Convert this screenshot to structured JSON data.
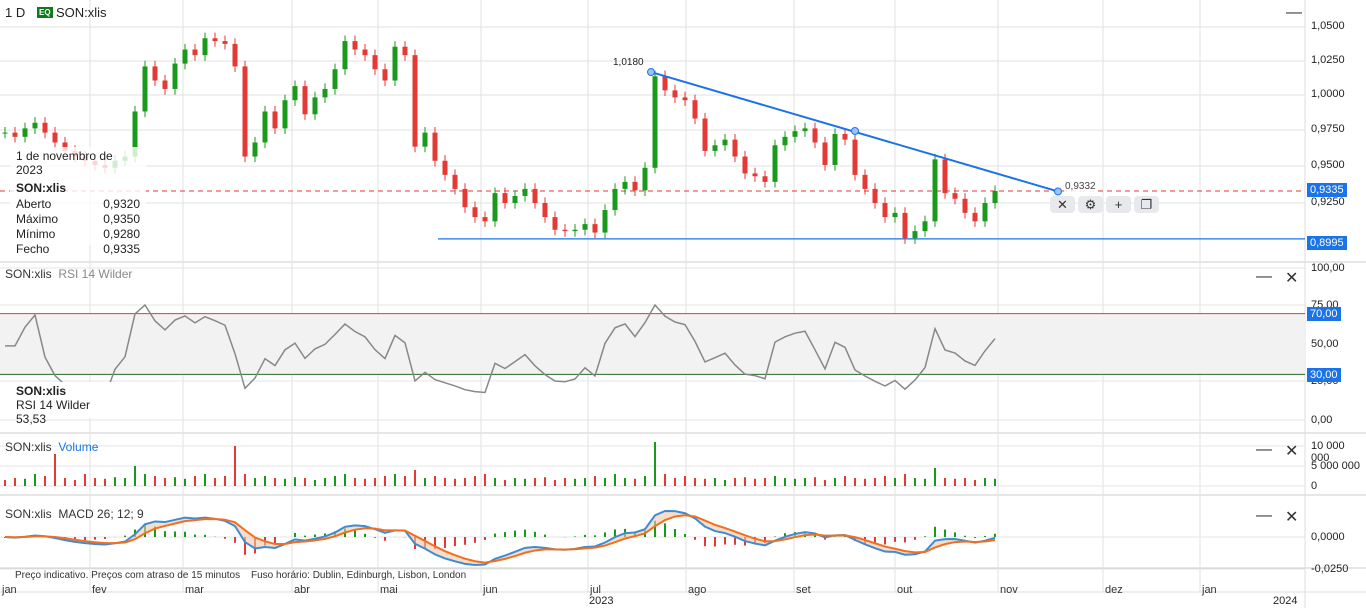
{
  "header": {
    "interval": "1 D",
    "badge": "EQ",
    "symbol": "SON:xlis"
  },
  "tooltip": {
    "date": "1 de novembro de 2023",
    "symbol": "SON:xlis",
    "rows": [
      {
        "label": "Aberto",
        "value": "0,9320"
      },
      {
        "label": "Máximo",
        "value": "0,9350"
      },
      {
        "label": "Mínimo",
        "value": "0,9280"
      },
      {
        "label": "Fecho",
        "value": "0,9335"
      }
    ]
  },
  "price_axis": {
    "ticks": [
      "1,0500",
      "1,0250",
      "1,0000",
      "0,9750",
      "0,9500",
      "0,9250"
    ],
    "last_price": "0,9335",
    "support_level": "0,8995"
  },
  "annotations": {
    "trend_high": "1,0180",
    "trend_end": "0,9332"
  },
  "drawing_toolbar": {
    "close": "✕",
    "settings": "⚙",
    "add": "+",
    "copy": "❐"
  },
  "rsi": {
    "title": "SON:xlis",
    "indicator": "RSI 14 Wilder",
    "legend_symbol": "SON:xlis",
    "legend_label": "RSI 14 Wilder",
    "value": "53,53",
    "ticks": [
      "100,00",
      "75,00",
      "50,00",
      "25,00",
      "0,00"
    ],
    "upper": "70,00",
    "lower": "30,00"
  },
  "volume": {
    "title": "SON:xlis",
    "indicator": "Volume",
    "ticks": [
      "10 000 000",
      "5 000 000",
      "0"
    ]
  },
  "macd": {
    "title": "SON:xlis",
    "indicator": "MACD 26; 12; 9",
    "ticks": [
      "0,0000",
      "-0,0250"
    ]
  },
  "footer": {
    "notice": "Preço indicativo. Preços com atraso de 15 minutos",
    "timezone": "Fuso horário: Dublin, Edinburgh, Lisbon, London"
  },
  "x_axis": {
    "months": [
      "jan",
      "fev",
      "mar",
      "abr",
      "mai",
      "jun",
      "jul",
      "ago",
      "set",
      "out",
      "nov",
      "dez",
      "jan"
    ],
    "years": [
      "2023",
      "2024"
    ]
  },
  "colors": {
    "up": "#1a9a1a",
    "down": "#e53935",
    "line": "#1a73e8",
    "macd": "#3b8bd6",
    "signal": "#f07020"
  },
  "chart_data": {
    "type": "candlestick",
    "closes": [
      0.975,
      0.972,
      0.978,
      0.982,
      0.975,
      0.968,
      0.962,
      0.958,
      0.955,
      0.952,
      0.95,
      0.955,
      0.958,
      0.99,
      1.022,
      1.012,
      1.006,
      1.024,
      1.034,
      1.03,
      1.042,
      1.04,
      1.038,
      1.022,
      0.958,
      0.968,
      0.99,
      0.978,
      0.998,
      1.008,
      0.988,
      1.0,
      1.006,
      1.02,
      1.04,
      1.034,
      1.03,
      1.02,
      1.012,
      1.036,
      1.03,
      0.965,
      0.975,
      0.955,
      0.945,
      0.935,
      0.922,
      0.915,
      0.912,
      0.932,
      0.925,
      0.93,
      0.935,
      0.925,
      0.915,
      0.906,
      0.905,
      0.906,
      0.91,
      0.904,
      0.92,
      0.935,
      0.94,
      0.934,
      0.95,
      1.015,
      1.005,
      1.0,
      0.998,
      0.985,
      0.962,
      0.966,
      0.97,
      0.958,
      0.946,
      0.944,
      0.94,
      0.966,
      0.972,
      0.976,
      0.978,
      0.968,
      0.952,
      0.974,
      0.97,
      0.945,
      0.935,
      0.925,
      0.915,
      0.918,
      0.9,
      0.905,
      0.912,
      0.956,
      0.932,
      0.928,
      0.918,
      0.912,
      0.925,
      0.9335
    ],
    "volumes_millions": [
      1.5,
      2,
      1.8,
      3,
      2.5,
      8,
      2,
      1.5,
      3,
      2,
      1.8,
      2.2,
      2,
      5,
      3,
      2.5,
      2,
      2.2,
      1.8,
      2.5,
      3,
      2,
      2.5,
      10,
      3,
      2,
      2.5,
      2,
      1.8,
      2.2,
      2,
      1.5,
      2,
      2.5,
      3,
      2,
      1.8,
      2,
      2.5,
      3,
      2.5,
      4,
      2,
      2.5,
      2,
      1.8,
      2,
      2.5,
      3,
      2,
      1.5,
      2,
      1.8,
      2,
      2.2,
      1.5,
      2,
      1.8,
      2,
      2.5,
      2,
      3,
      2,
      1.8,
      2.5,
      11,
      3,
      2,
      2.5,
      2,
      1.8,
      2,
      1.5,
      2,
      2.2,
      1.8,
      2,
      2.5,
      2,
      1.8,
      2,
      2.2,
      1.5,
      2,
      2.5,
      2,
      1.8,
      2,
      2.5,
      2,
      3,
      2,
      1.8,
      4.5,
      2,
      1.8,
      2,
      1.5,
      2,
      1.8
    ],
    "price_range": [
      0.89,
      1.06
    ],
    "rsi_range": [
      0,
      100
    ],
    "volume_range_millions": [
      0,
      10
    ],
    "trendline": [
      1.018,
      0.9332
    ],
    "support": 0.8995
  }
}
